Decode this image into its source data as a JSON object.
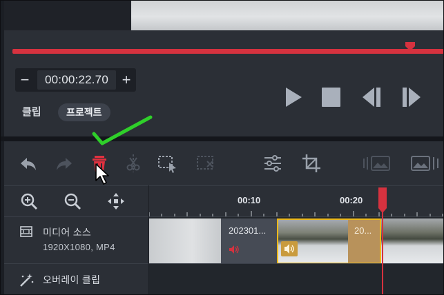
{
  "player": {
    "timecode": "00:00:22.70",
    "minus_label": "−",
    "plus_label": "+",
    "seek_progress": 0.93,
    "modes": {
      "clip": "클립",
      "project": "프로젝트"
    },
    "accent_color": "#d6323f"
  },
  "toolbar": {
    "icons": [
      "undo-icon",
      "redo-icon",
      "delete-icon",
      "split-icon",
      "select-range-icon",
      "deselect-icon",
      "adjust-icon",
      "crop-icon",
      "image-insert-icon",
      "image-icon"
    ]
  },
  "timeline": {
    "ruler": {
      "labels": [
        "00:10",
        "00:20"
      ]
    },
    "tracks": {
      "media": {
        "title": "미디어 소스",
        "subtitle": "1920X1080, MP4"
      },
      "overlay": {
        "title": "오버레이 클립"
      }
    },
    "clips": [
      {
        "label": ""
      },
      {
        "label": "202301..."
      },
      {
        "label": "20...",
        "selected": true,
        "highlight_color": "#ecb81a"
      },
      {
        "label": ""
      }
    ]
  }
}
